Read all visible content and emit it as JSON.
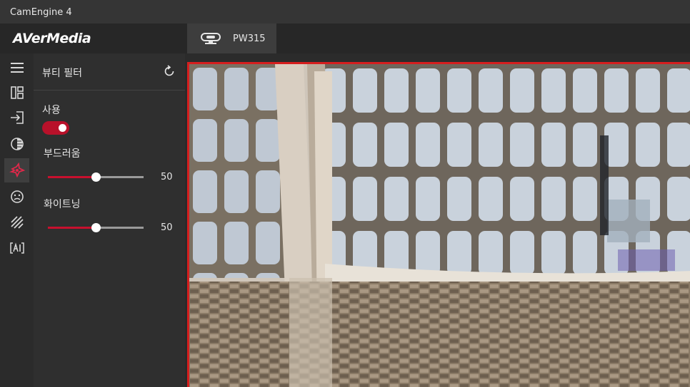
{
  "window": {
    "title": "CamEngine 4"
  },
  "brand": {
    "logo_text": "AVerMedia"
  },
  "device_tab": {
    "label": "PW315"
  },
  "rail": {
    "icons": [
      "menu-icon",
      "layout-icon",
      "input-icon",
      "contrast-icon",
      "beauty-filter-icon",
      "face-icon",
      "stripes-icon",
      "ai-icon"
    ],
    "active_index": 4
  },
  "panel": {
    "title": "뷰티 필터",
    "enable_label": "사용",
    "enabled": true,
    "smoothness": {
      "label": "부드러움",
      "value": "50",
      "fraction": 0.5
    },
    "whitening": {
      "label": "화이트닝",
      "value": "50",
      "fraction": 0.5
    }
  },
  "colors": {
    "accent": "#c8102e",
    "frame": "#d61e1e"
  }
}
